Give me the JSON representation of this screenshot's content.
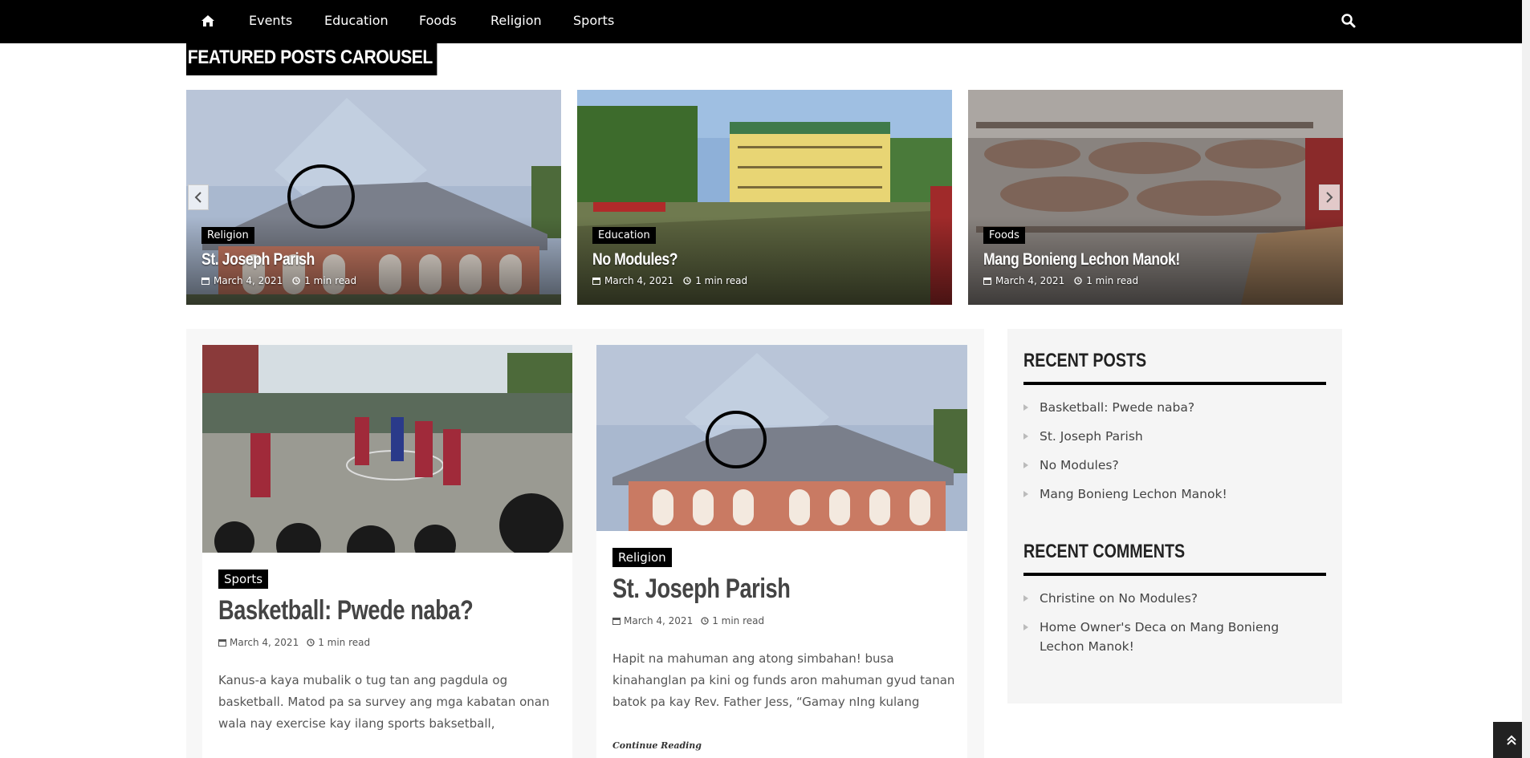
{
  "nav": {
    "home_icon": "home-icon",
    "items": [
      "Events",
      "Education",
      "Foods",
      "Religion",
      "Sports"
    ],
    "search_icon": "search-icon"
  },
  "featured": {
    "title": "FEATURED POSTS CAROUSEL",
    "slides": [
      {
        "category": "Religion",
        "title": "St. Joseph Parish",
        "date": "March 4, 2021",
        "read": "1 min read"
      },
      {
        "category": "Education",
        "title": "No Modules?",
        "date": "March 4, 2021",
        "read": "1 min read"
      },
      {
        "category": "Foods",
        "title": "Mang Bonieng Lechon Manok!",
        "date": "March 4, 2021",
        "read": "1 min read"
      }
    ],
    "prev_icon": "chevron-left-icon",
    "next_icon": "chevron-right-icon"
  },
  "posts": [
    {
      "category": "Sports",
      "title": "Basketball: Pwede naba?",
      "date": "March 4, 2021",
      "read": "1 min read",
      "excerpt_lines": [
        "Kanus-a kaya mubalik o tug tan ang pagdula og",
        "basketball. Matod pa sa survey ang mga kabatan onan",
        "wala nay exercise kay ilang sports baksetball,"
      ]
    },
    {
      "category": "Religion",
      "title": "St. Joseph Parish",
      "date": "March 4, 2021",
      "read": "1 min read",
      "excerpt_lines": [
        "Hapit na mahuman ang atong simbahan! busa",
        "kinahanglan pa kini og funds aron mahuman gyud tanan",
        "batok pa kay Rev. Father Jess, “Gamay nIng kulang"
      ],
      "more": "Continue Reading"
    }
  ],
  "sidebar": {
    "recent_posts_title": "RECENT POSTS",
    "recent_posts": [
      "Basketball: Pwede naba?",
      "St. Joseph Parish",
      "No Modules?",
      "Mang Bonieng Lechon Manok!"
    ],
    "recent_comments_title": "RECENT COMMENTS",
    "recent_comments": [
      {
        "author": "Christine",
        "on": "on",
        "post": "No Modules?"
      },
      {
        "author": "Home Owner's Deca",
        "on": "on",
        "post": "Mang Bonieng Lechon Manok!"
      }
    ]
  },
  "back_to_top_icon": "double-chevron-up-icon"
}
